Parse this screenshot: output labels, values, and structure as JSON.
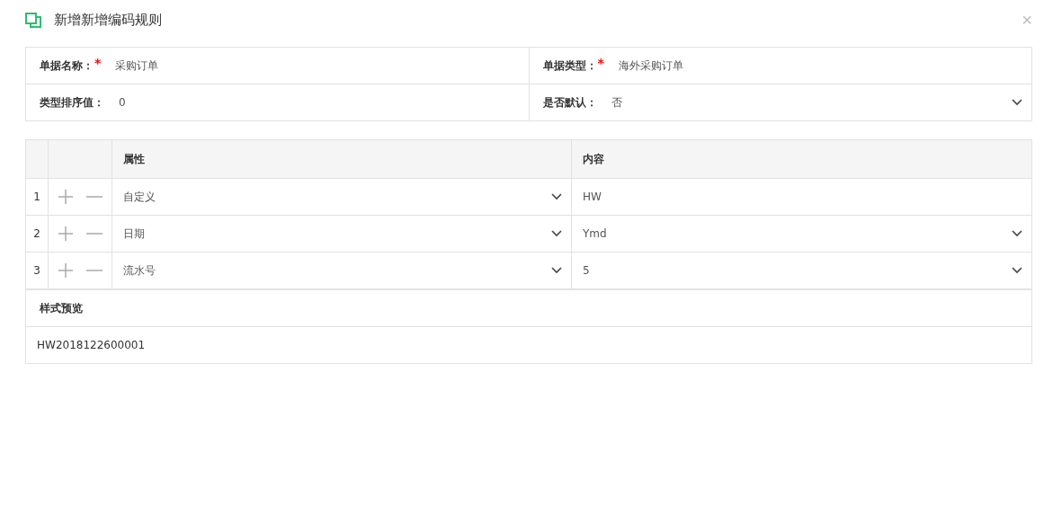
{
  "dialog": {
    "title": "新增新增编码规则",
    "close": "×"
  },
  "form": {
    "rows": [
      [
        {
          "label": "单据名称：",
          "required_mark": "*",
          "kind": "text",
          "value": "采购订单"
        },
        {
          "label": "单据类型：",
          "required_mark": "*",
          "kind": "text",
          "value": "海外采购订单"
        }
      ],
      [
        {
          "label": "类型排序值：",
          "kind": "text",
          "value": "0"
        },
        {
          "label": "是否默认：",
          "kind": "select",
          "value": "否"
        }
      ]
    ]
  },
  "rules": {
    "columns": [
      "属性",
      "内容"
    ],
    "rows": [
      {
        "index": "1",
        "property": "自定义",
        "content": {
          "kind": "text",
          "value": "HW"
        }
      },
      {
        "index": "2",
        "property": "日期",
        "content": {
          "kind": "select",
          "value": "Ymd"
        }
      },
      {
        "index": "3",
        "property": "流水号",
        "content": {
          "kind": "select",
          "value": "5"
        }
      }
    ]
  },
  "preview": {
    "heading": "样式预览",
    "value": "HW2018122600001"
  }
}
